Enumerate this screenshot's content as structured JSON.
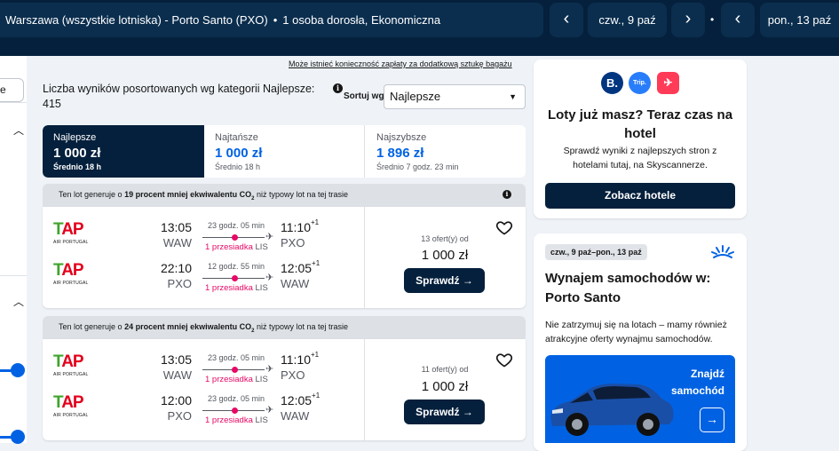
{
  "header": {
    "route": "Warszawa (wszystkie lotniska) - Porto Santo (PXO)",
    "bullet": "•",
    "passengers": "1 osoba dorosła, Ekonomiczna",
    "depart_date": "czw., 9 paź",
    "return_date": "pon., 13 paź",
    "separator": "•",
    "prev_label": "‹",
    "next_label": "›"
  },
  "sidebar": {
    "partial_label": "e"
  },
  "results": {
    "bag_note": "Może istnieć konieczność zapłaty za dodatkową sztukę bagażu",
    "count_text": "Liczba wyników posortowanych wg kategorii Najlepsze: 415",
    "sort_label": "Sortuj wg",
    "sort_value": "Najlepsze"
  },
  "tabs": [
    {
      "label": "Najlepsze",
      "price": "1 000 zł",
      "avg": "Średnio 18 h"
    },
    {
      "label": "Najtańsze",
      "price": "1 000 zł",
      "avg": "Średnio 18 h"
    },
    {
      "label": "Najszybsze",
      "price": "1 896 zł",
      "avg": "Średnio 7 godz. 23 min"
    }
  ],
  "flights": [
    {
      "co2_pre": "Ten lot generuje o ",
      "co2_bold": "19 procent mniej ekwiwalentu CO",
      "co2_sub": "2",
      "co2_post": " niż typowy lot na tej trasie",
      "offers": "13 ofert(y) od",
      "price": "1 000 zł",
      "cta": "Sprawdź →",
      "legs": [
        {
          "airline": "AIR PORTUGAL",
          "dep_time": "13:05",
          "dep_ap": "WAW",
          "duration": "23 godz. 05 min",
          "stops": "1 przesiadka",
          "via": "LIS",
          "arr_time": "11:10",
          "arr_plus": "+1",
          "arr_ap": "PXO"
        },
        {
          "airline": "AIR PORTUGAL",
          "dep_time": "22:10",
          "dep_ap": "PXO",
          "duration": "12 godz. 55 min",
          "stops": "1 przesiadka",
          "via": "LIS",
          "arr_time": "12:05",
          "arr_plus": "+1",
          "arr_ap": "WAW"
        }
      ]
    },
    {
      "co2_pre": "Ten lot generuje o ",
      "co2_bold": "24 procent mniej ekwiwalentu CO",
      "co2_sub": "2",
      "co2_post": " niż typowy lot na tej trasie",
      "offers": "11 ofert(y) od",
      "price": "1 000 zł",
      "cta": "Sprawdź →",
      "legs": [
        {
          "airline": "AIR PORTUGAL",
          "dep_time": "13:05",
          "dep_ap": "WAW",
          "duration": "23 godz. 05 min",
          "stops": "1 przesiadka",
          "via": "LIS",
          "arr_time": "11:10",
          "arr_plus": "+1",
          "arr_ap": "PXO"
        },
        {
          "airline": "AIR PORTUGAL",
          "dep_time": "12:00",
          "dep_ap": "PXO",
          "duration": "23 godz. 05 min",
          "stops": "1 przesiadka",
          "via": "LIS",
          "arr_time": "12:05",
          "arr_plus": "+1",
          "arr_ap": "WAW"
        }
      ]
    }
  ],
  "hotel_ad": {
    "brands": [
      "B.",
      "Trip.",
      "✈"
    ],
    "brand_colors": [
      "#003580",
      "#287dfa",
      "#ff3b57"
    ],
    "title": "Loty już masz? Teraz czas na hotel",
    "description": "Sprawdź wyniki z najlepszych stron z hotelami tutaj, na Skyscannerze.",
    "cta": "Zobacz hotele"
  },
  "car_ad": {
    "dates": "czw., 9 paź–pon., 13 paź",
    "title": "Wynajem samochodów w: Porto Santo",
    "description": "Nie zatrzymuj się na lotach – mamy również atrakcyjne oferty wynajmu samochodów.",
    "cta": "Znajdź samochód",
    "cta_arrow": "→"
  },
  "colors": {
    "navy": "#05203c",
    "accent": "#0062e3",
    "stop": "#e70866",
    "tap_green": "#3fa52c",
    "tap_red": "#e3001b"
  }
}
